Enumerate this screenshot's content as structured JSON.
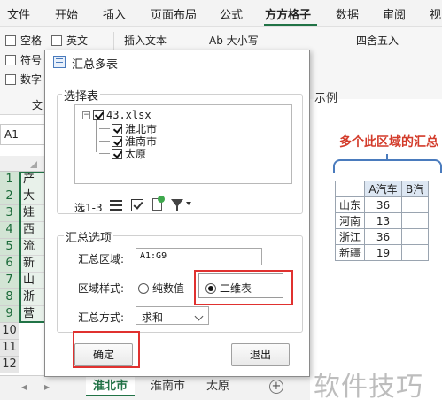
{
  "menu": {
    "items": [
      "文件",
      "开始",
      "插入",
      "页面布局",
      "公式",
      "方方格子",
      "数据",
      "审阅",
      "视"
    ],
    "active": "方方格子"
  },
  "ribbon": {
    "checks": [
      "空格",
      "英文",
      "符号",
      "数字"
    ],
    "insert_text": "插入文本",
    "ab_case": "Ab 大小写",
    "round": "四舍五入",
    "group_label": "文"
  },
  "namebox": "A1",
  "rows": [
    "1",
    "2",
    "3",
    "4",
    "5",
    "6",
    "7",
    "8",
    "9",
    "10",
    "11",
    "12"
  ],
  "cells": [
    "产",
    "大",
    "娃",
    "西",
    "流",
    "新",
    "山",
    "浙",
    "营"
  ],
  "sheets": {
    "tabs": [
      "淮北市",
      "淮南市",
      "太原"
    ],
    "active": "淮北市",
    "add": "+"
  },
  "example": {
    "label": "示例",
    "title": "多个此区域的汇总",
    "headers": [
      "A汽车",
      "B汽"
    ],
    "rows": [
      {
        "name": "山东",
        "value": "36"
      },
      {
        "name": "河南",
        "value": "13"
      },
      {
        "name": "浙江",
        "value": "36"
      },
      {
        "name": "新疆",
        "value": "19"
      }
    ]
  },
  "dialog": {
    "title": "汇总多表",
    "select_group": "选择表",
    "tree": {
      "file": "43.xlsx",
      "sheets": [
        "淮北市",
        "淮南市",
        "太原"
      ]
    },
    "selection_count": "选1-3",
    "options_group": "汇总选项",
    "range_label": "汇总区域:",
    "range_value": "A1:G9",
    "style_label": "区域样式:",
    "style_option_plain": "纯数值",
    "style_option_2d": "二维表",
    "method_label": "汇总方式:",
    "method_value": "求和",
    "ok": "确定",
    "exit": "退出"
  },
  "watermark": "软件技巧",
  "colors": {
    "excel_green": "#217346",
    "highlight_red": "#e0312f",
    "example_title_red": "#d33b2a"
  }
}
